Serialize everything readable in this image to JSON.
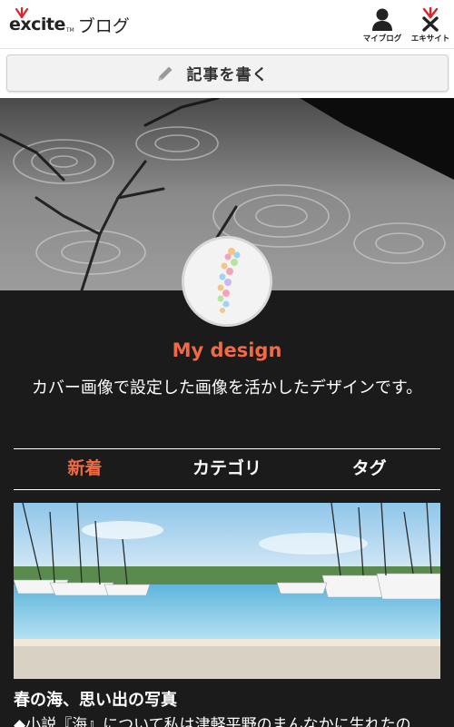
{
  "header": {
    "logo_text": "excite",
    "logo_tm": "TM",
    "logo_suffix": "ブログ",
    "my_blog_label": "マイブログ",
    "excite_site_label": "エキサイト",
    "my_blog_icon": "user-icon",
    "excite_icon": "excite-mark-icon"
  },
  "write_button": {
    "label": "記事を書く",
    "icon": "pencil-icon"
  },
  "blog": {
    "title": "My design",
    "description": "カバー画像で設定した画像を活かしたデザインです。"
  },
  "tabs": [
    {
      "label": "新着",
      "active": true
    },
    {
      "label": "カテゴリ",
      "active": false
    },
    {
      "label": "タグ",
      "active": false
    }
  ],
  "article": {
    "title": "春の海、思い出の写真",
    "excerpt": "◆小説『海』について私は津軽平野のまんなかに生れたの"
  },
  "colors": {
    "accent": "#f06a45",
    "background": "#1b1b1b",
    "logo_red": "#d9252a"
  }
}
